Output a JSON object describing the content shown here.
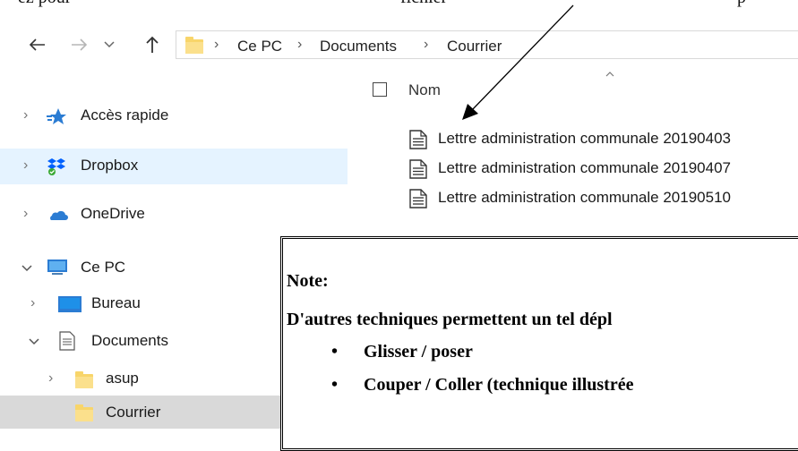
{
  "caption": {
    "part1": "ez pour",
    "part2": "fichier",
    "part3": "p"
  },
  "navigation": {
    "back_icon": "arrow-left-icon",
    "forward_icon": "arrow-right-icon",
    "recent_icon": "chevron-down-icon",
    "up_icon": "arrow-up-icon"
  },
  "address_bar": {
    "crumbs": [
      "Ce PC",
      "Documents",
      "Courrier"
    ]
  },
  "sidebar": {
    "items": [
      {
        "label": "Accès rapide",
        "icon": "star-icon"
      },
      {
        "label": "Dropbox",
        "icon": "dropbox-icon"
      },
      {
        "label": "OneDrive",
        "icon": "cloud-icon"
      },
      {
        "label": "Ce PC",
        "icon": "computer-icon"
      },
      {
        "label": "Bureau",
        "icon": "desktop-icon"
      },
      {
        "label": "Documents",
        "icon": "documents-icon"
      },
      {
        "label": "asup",
        "icon": "folder-icon"
      },
      {
        "label": "Courrier",
        "icon": "folder-icon"
      }
    ]
  },
  "file_list": {
    "column_name": "Nom",
    "files": [
      {
        "name": "Lettre administration communale 20190403",
        "icon": "document-icon"
      },
      {
        "name": "Lettre administration communale 20190407",
        "icon": "document-icon"
      },
      {
        "name": "Lettre administration communale 20190510",
        "icon": "document-icon"
      }
    ]
  },
  "note": {
    "title": "Note:",
    "text": "D'autres techniques permettent un tel dépl",
    "bullets": [
      "Glisser / poser",
      "Couper / Coller (technique illustrée"
    ]
  },
  "colors": {
    "selected_light": "#e5f3ff",
    "selected_gray": "#d9d9d9",
    "folder": "#f8d56a",
    "accent_blue": "#2b7cd3"
  }
}
